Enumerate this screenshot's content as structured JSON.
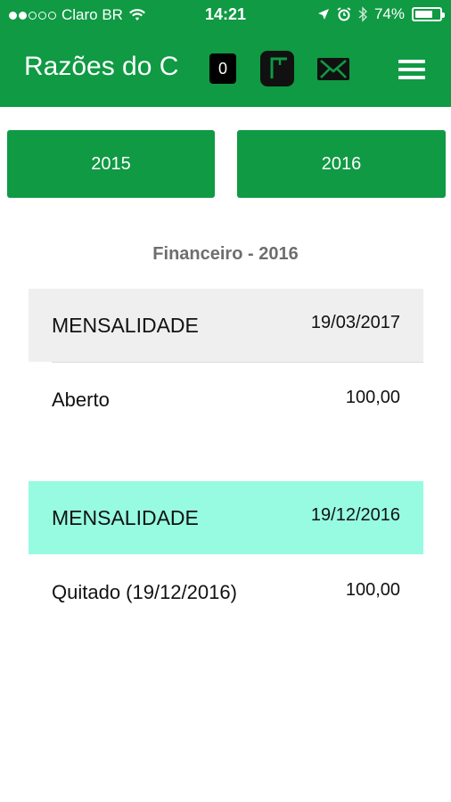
{
  "status_bar": {
    "carrier": "Claro BR",
    "time": "14:21",
    "battery": "74%",
    "battery_level": 0.74,
    "signal_filled": 2,
    "signal_total": 5
  },
  "app_bar": {
    "title": "Razões do C",
    "badge_count": "0",
    "icons": [
      "f-app-icon",
      "mail-icon",
      "menu-icon"
    ]
  },
  "year_buttons": [
    {
      "label": "2015"
    },
    {
      "label": "2016"
    }
  ],
  "section_title": "Financeiro - 2016",
  "entries": [
    {
      "type": "MENSALIDADE",
      "date": "19/03/2017",
      "status": "Aberto",
      "value": "100,00",
      "highlight_color": "#efefef"
    },
    {
      "type": "MENSALIDADE",
      "date": "19/12/2016",
      "status": "Quitado (19/12/2016)",
      "value": "100,00",
      "highlight_color": "#96fbe1"
    }
  ],
  "colors": {
    "primary": "#0f9a43",
    "paid_highlight": "#96fbe1",
    "open_highlight": "#efefef"
  }
}
